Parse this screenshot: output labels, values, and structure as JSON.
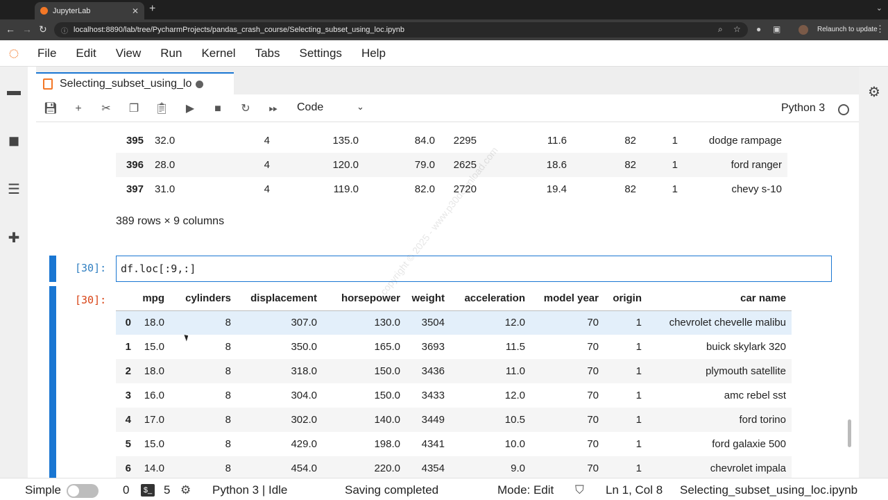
{
  "browser": {
    "tab_title": "JupyterLab",
    "url": "localhost:8890/lab/tree/PycharmProjects/pandas_crash_course/Selecting_subset_using_loc.ipynb",
    "relaunch_label": "Relaunch to update"
  },
  "menubar": {
    "items": [
      "File",
      "Edit",
      "View",
      "Run",
      "Kernel",
      "Tabs",
      "Settings",
      "Help"
    ]
  },
  "document": {
    "tab_title": "Selecting_subset_using_lo",
    "cell_type": "Code",
    "kernel": "Python 3"
  },
  "prev_output": {
    "rows": [
      [
        "395",
        "32.0",
        "4",
        "135.0",
        "84.0",
        "2295",
        "11.6",
        "82",
        "1",
        "dodge rampage"
      ],
      [
        "396",
        "28.0",
        "4",
        "120.0",
        "79.0",
        "2625",
        "18.6",
        "82",
        "1",
        "ford ranger"
      ],
      [
        "397",
        "31.0",
        "4",
        "119.0",
        "82.0",
        "2720",
        "19.4",
        "82",
        "1",
        "chevy s-10"
      ]
    ],
    "row_count": "389 rows × 9 columns"
  },
  "cell": {
    "in_prompt": "[30]:",
    "out_prompt": "[30]:",
    "code": "df.loc[:9,:]"
  },
  "output_table": {
    "columns": [
      "mpg",
      "cylinders",
      "displacement",
      "horsepower",
      "weight",
      "acceleration",
      "model year",
      "origin",
      "car name"
    ],
    "rows": [
      [
        "0",
        "18.0",
        "8",
        "307.0",
        "130.0",
        "3504",
        "12.0",
        "70",
        "1",
        "chevrolet chevelle malibu"
      ],
      [
        "1",
        "15.0",
        "8",
        "350.0",
        "165.0",
        "3693",
        "11.5",
        "70",
        "1",
        "buick skylark 320"
      ],
      [
        "2",
        "18.0",
        "8",
        "318.0",
        "150.0",
        "3436",
        "11.0",
        "70",
        "1",
        "plymouth satellite"
      ],
      [
        "3",
        "16.0",
        "8",
        "304.0",
        "150.0",
        "3433",
        "12.0",
        "70",
        "1",
        "amc rebel sst"
      ],
      [
        "4",
        "17.0",
        "8",
        "302.0",
        "140.0",
        "3449",
        "10.5",
        "70",
        "1",
        "ford torino"
      ],
      [
        "5",
        "15.0",
        "8",
        "429.0",
        "198.0",
        "4341",
        "10.0",
        "70",
        "1",
        "ford galaxie 500"
      ],
      [
        "6",
        "14.0",
        "8",
        "454.0",
        "220.0",
        "4354",
        "9.0",
        "70",
        "1",
        "chevrolet impala"
      ]
    ]
  },
  "statusbar": {
    "mode_label": "Simple",
    "zero": "0",
    "terminals": "5",
    "kernel_state": "Python 3 | Idle",
    "save_state": "Saving completed",
    "mode": "Mode: Edit",
    "cursor_pos": "Ln 1, Col 8",
    "filename": "Selecting_subset_using_loc.ipynb"
  },
  "watermark": "copyright © 2025 - www.p30download.com"
}
